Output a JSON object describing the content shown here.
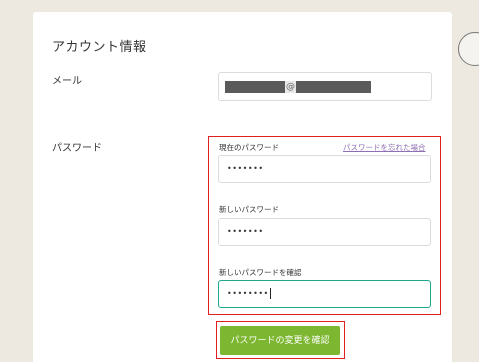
{
  "section": {
    "title": "アカウント情報"
  },
  "email": {
    "label": "メール",
    "value_masked": "@"
  },
  "password": {
    "label": "パスワード",
    "current_label": "現在のパスワード",
    "forgot_link": "パスワードを忘れた場合",
    "current_value": "•••••••",
    "new_label": "新しいパスワード",
    "new_value": "•••••••",
    "confirm_label": "新しいパスワードを確認",
    "confirm_value": "••••••••"
  },
  "submit": {
    "label": "パスワードの変更を確認"
  },
  "colors": {
    "background": "#ede9e1",
    "card": "#ffffff",
    "highlight": "#e0201f",
    "focus_border": "#1ca88b",
    "button": "#7db630",
    "link": "#8f6fb3"
  }
}
